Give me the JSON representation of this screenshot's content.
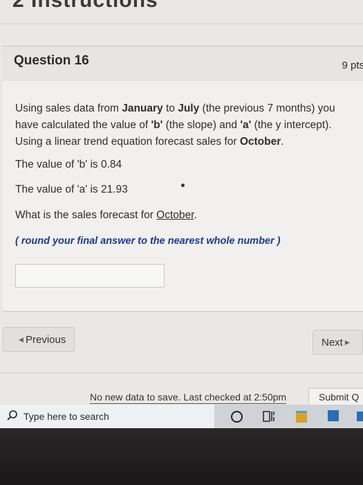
{
  "page": {
    "top_heading": "2 Instructions"
  },
  "question": {
    "title": "Question 16",
    "points": "9 pts",
    "intro": {
      "t1": "Using sales data from ",
      "b1": "January",
      "t2": " to ",
      "b2": "July",
      "t3": " (the previous 7 months) you have calculated the value of ",
      "b3": "'b'",
      "t4": " (the slope) and ",
      "b4": "'a'",
      "t5": " (the y intercept). Using a linear trend equation forecast sales for ",
      "b5": "October",
      "t6": "."
    },
    "b_value": "The value of 'b' is 0.84",
    "a_value": "The value of 'a' is 21.93",
    "prompt": {
      "t1": "What is the sales forecast for ",
      "u1": "October",
      "t2": "."
    },
    "note": "( round your final answer to the nearest whole number )",
    "answer": {
      "value": "",
      "placeholder": ""
    }
  },
  "nav": {
    "previous_label": "Previous",
    "next_label": "Next"
  },
  "footer": {
    "status": "No new data to save. Last checked at 2:50pm",
    "submit_label": "Submit Q"
  },
  "taskbar": {
    "search_placeholder": "Type here to search",
    "icons": [
      "search-icon",
      "cortana-icon",
      "task-view-icon",
      "file-explorer-icon",
      "store-icon",
      "edge-icon"
    ]
  }
}
